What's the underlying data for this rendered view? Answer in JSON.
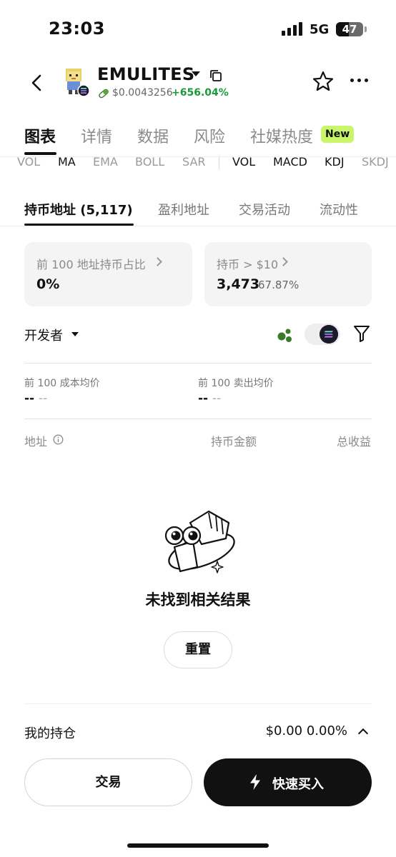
{
  "status_bar": {
    "time": "23:03",
    "network": "5G",
    "battery": "47",
    "battery_level": 0.47
  },
  "header": {
    "token_name": "EMULITES",
    "price": "$0.0043256",
    "change": "+656.04%",
    "icons": [
      "back-icon",
      "token-avatar",
      "solana-badge-icon",
      "caret-down-icon",
      "copy-icon",
      "pill-icon",
      "star-icon",
      "more-icon"
    ]
  },
  "main_tabs": [
    {
      "label": "图表",
      "active": true
    },
    {
      "label": "详情",
      "active": false
    },
    {
      "label": "数据",
      "active": false
    },
    {
      "label": "风险",
      "active": false
    },
    {
      "label": "社媒热度",
      "active": false
    }
  ],
  "new_badge": "New",
  "indicators": [
    "VOL",
    "MA",
    "EMA",
    "BOLL",
    "SAR",
    "VOL",
    "MACD",
    "KDJ",
    "SKDJ"
  ],
  "sub_tabs": [
    {
      "label": "持币地址 (5,117)",
      "active": true
    },
    {
      "label": "盈利地址",
      "active": false
    },
    {
      "label": "交易活动",
      "active": false
    },
    {
      "label": "流动性",
      "active": false
    }
  ],
  "cards": [
    {
      "label": "前 100 地址持币占比",
      "value": "0%",
      "sub": ""
    },
    {
      "label": "持币 > $10",
      "value": "3,473",
      "sub": "67.87%"
    }
  ],
  "filter": {
    "label": "开发者"
  },
  "averages": [
    {
      "label": "前 100 成本均价",
      "value": "--",
      "sub": "--"
    },
    {
      "label": "前 100 卖出均价",
      "value": "--",
      "sub": "--"
    }
  ],
  "columns": [
    "地址",
    "持币金额",
    "总收益"
  ],
  "empty_state": {
    "message": "未找到相关结果",
    "reset": "重置"
  },
  "holdings": {
    "label": "我的持仓",
    "value": "$0.00 0.00%"
  },
  "actions": {
    "trade": "交易",
    "quick_buy": "快速买入"
  },
  "colors": {
    "positive": "#1a9a3a",
    "new_badge": "#c8f56a",
    "primary_button": "#111111",
    "accent_green": "#3b7a2a"
  }
}
